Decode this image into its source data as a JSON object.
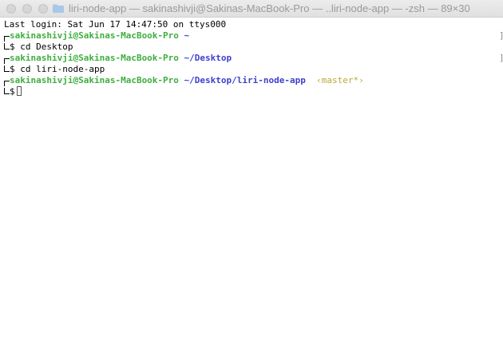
{
  "window": {
    "title": "liri-node-app — sakinashivji@Sakinas-MacBook-Pro — ..liri-node-app — -zsh — 89×30"
  },
  "terminal": {
    "last_login": "Last login: Sat Jun 17 14:47:50 on ttys000",
    "prompts": [
      {
        "user": "sakinashivji@Sakinas-MacBook-Pro",
        "path": "~",
        "branch": "",
        "command": "cd Desktop"
      },
      {
        "user": "sakinashivji@Sakinas-MacBook-Pro",
        "path": "~/Desktop",
        "branch": "",
        "command": "cd liri-node-app"
      },
      {
        "user": "sakinashivji@Sakinas-MacBook-Pro",
        "path": "~/Desktop/liri-node-app",
        "branch": "‹master*›",
        "command": ""
      }
    ],
    "prompt_symbol": "$",
    "right_marker": "]"
  },
  "colors": {
    "user": "#3fae3f",
    "path": "#3f3fd0",
    "branch": "#b8a93a"
  }
}
